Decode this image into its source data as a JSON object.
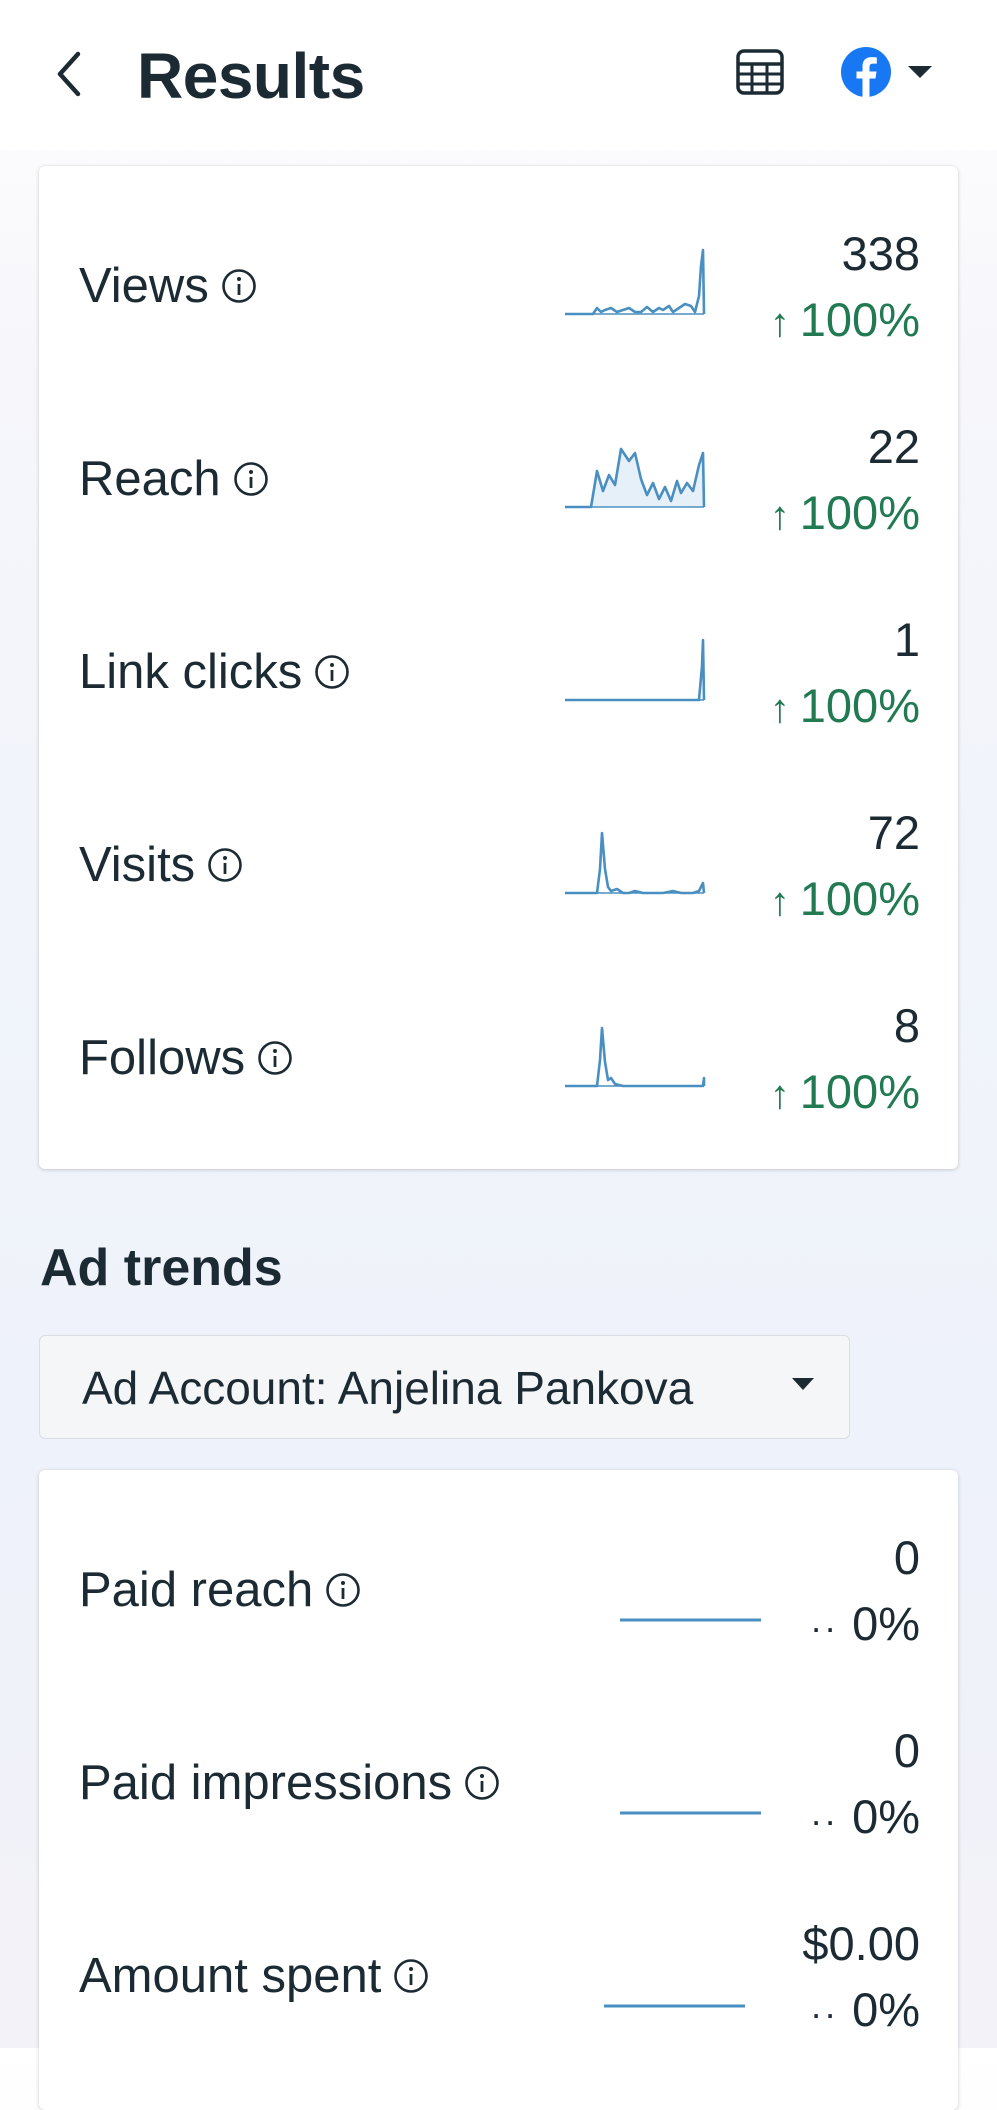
{
  "header": {
    "title": "Results",
    "back_icon": "chevron-left-icon",
    "table_icon": "table-icon",
    "platform_icon": "facebook-icon",
    "dropdown_icon": "caret-down-icon"
  },
  "results": [
    {
      "label": "Views",
      "value": "338",
      "change": "100%",
      "trend": "up"
    },
    {
      "label": "Reach",
      "value": "22",
      "change": "100%",
      "trend": "up"
    },
    {
      "label": "Link clicks",
      "value": "1",
      "change": "100%",
      "trend": "up"
    },
    {
      "label": "Visits",
      "value": "72",
      "change": "100%",
      "trend": "up"
    },
    {
      "label": "Follows",
      "value": "8",
      "change": "100%",
      "trend": "up"
    }
  ],
  "ad_trends": {
    "title": "Ad trends",
    "account_selector": "Ad Account: Anjelina Pankova",
    "metrics": [
      {
        "label": "Paid reach",
        "value": "0",
        "change": "0%",
        "trend": "flat"
      },
      {
        "label": "Paid impressions",
        "value": "0",
        "change": "0%",
        "trend": "flat"
      },
      {
        "label": "Amount spent",
        "value": "$0.00",
        "change": "0%",
        "trend": "flat"
      }
    ]
  },
  "colors": {
    "positive": "#217a52",
    "sparkline": "#4a8fc1",
    "facebook_blue": "#1877f2",
    "text": "#1c2b33"
  }
}
